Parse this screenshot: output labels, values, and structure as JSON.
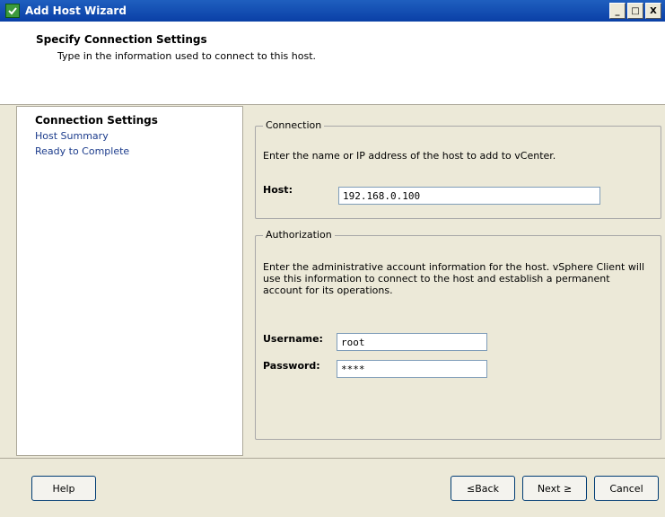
{
  "window": {
    "title": "Add Host Wizard",
    "icon": "wizard-app-icon",
    "min_label": "_",
    "max_label": "□",
    "close_label": "X"
  },
  "header": {
    "title": "Specify Connection Settings",
    "subtitle": "Type in the information used to connect to this host."
  },
  "nav": {
    "items": [
      {
        "label": "Connection Settings",
        "active": true
      },
      {
        "label": "Host Summary",
        "active": false
      },
      {
        "label": "Ready to Complete",
        "active": false
      }
    ]
  },
  "connection": {
    "group_title": "Connection",
    "description": "Enter the name or IP address of the host to add to vCenter.",
    "host_label": "Host:",
    "host_value": "192.168.0.100"
  },
  "authorization": {
    "group_title": "Authorization",
    "description_lines": [
      "Enter the administrative account information for the host. vSphere Client will",
      "use this information to connect to the host and establish a permanent",
      "account for its operations."
    ],
    "username_label": "Username:",
    "username_value": "root",
    "password_label": "Password:",
    "password_value": "****"
  },
  "footer": {
    "help_label": "Help",
    "back_label": "≤Back",
    "next_label": "Next ≥",
    "cancel_label": "Cancel"
  }
}
